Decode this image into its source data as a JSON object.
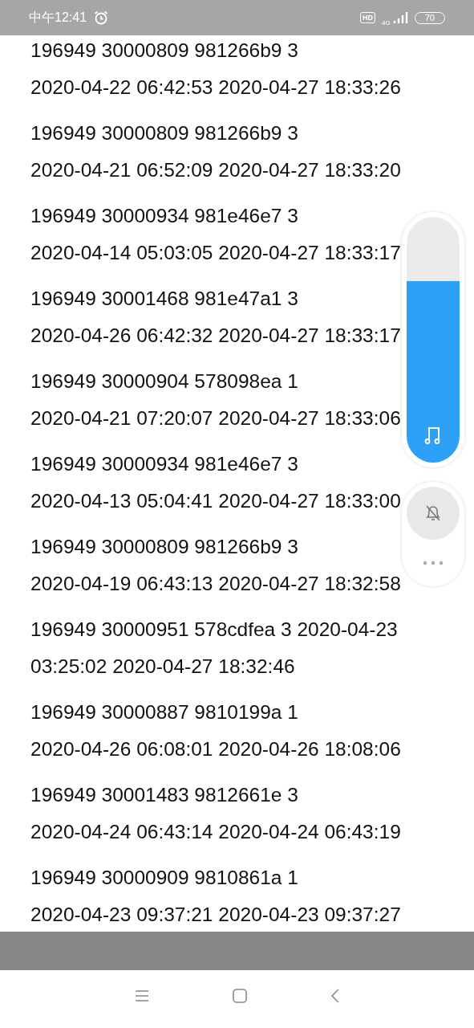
{
  "status_bar": {
    "time": "中午12:41",
    "hd": "HD",
    "network": "4G",
    "battery": "70"
  },
  "records": [
    {
      "lines": [
        "196949 30000809 981266b9 3",
        "2020-04-22 06:42:53 2020-04-27 18:33:26"
      ]
    },
    {
      "lines": [
        "196949 30000809 981266b9 3",
        "2020-04-21 06:52:09 2020-04-27 18:33:20"
      ]
    },
    {
      "lines": [
        "196949 30000934 981e46e7 3",
        "2020-04-14 05:03:05 2020-04-27 18:33:17"
      ]
    },
    {
      "lines": [
        "196949 30001468 981e47a1 3",
        "2020-04-26 06:42:32 2020-04-27 18:33:17"
      ]
    },
    {
      "lines": [
        "196949 30000904 578098ea 1",
        "2020-04-21 07:20:07 2020-04-27 18:33:06"
      ]
    },
    {
      "lines": [
        "196949 30000934 981e46e7 3",
        "2020-04-13 05:04:41 2020-04-27 18:33:00"
      ]
    },
    {
      "lines": [
        "196949 30000809 981266b9 3",
        "2020-04-19 06:43:13 2020-04-27 18:32:58"
      ]
    },
    {
      "lines": [
        "196949 30000951 578cdfea 3 2020-04-23",
        "03:25:02 2020-04-27 18:32:46"
      ]
    },
    {
      "lines": [
        "196949 30000887 9810199a 1",
        "2020-04-26 06:08:01 2020-04-26 18:08:06"
      ]
    },
    {
      "lines": [
        "196949 30001483 9812661e 3",
        "2020-04-24 06:43:14 2020-04-24 06:43:19"
      ]
    },
    {
      "lines": [
        "196949 30000909 9810861a 1",
        "2020-04-23 09:37:21 2020-04-23 09:37:27"
      ]
    }
  ],
  "volume_panel": {
    "level": 0.74,
    "ringer_muted": true
  }
}
